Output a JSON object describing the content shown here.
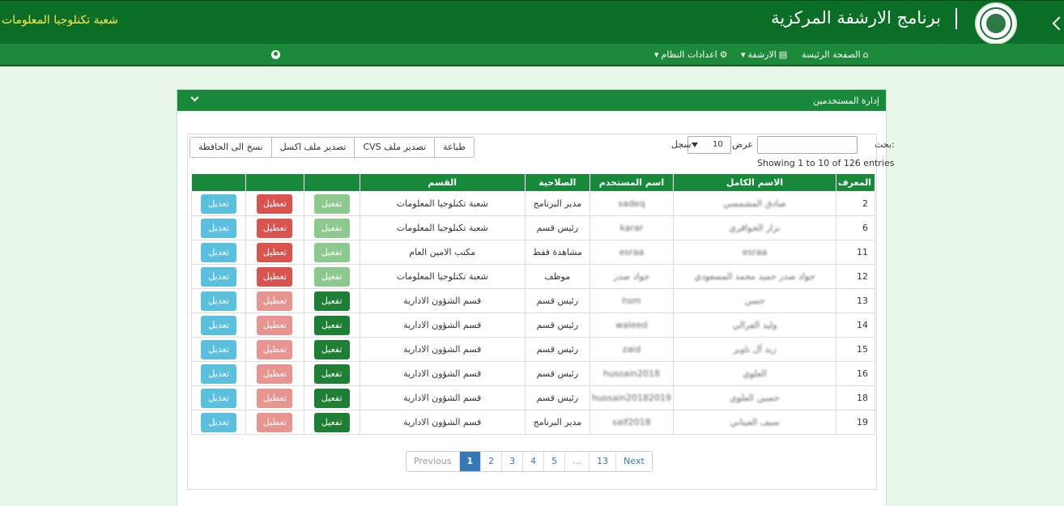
{
  "header": {
    "app_title": "برنامج الارشفة المركزية",
    "department": "شعبة تكنلوجيا المعلومات"
  },
  "nav": {
    "home": "الصفحة الرئيسة",
    "archive": "الارشفة",
    "settings": "اعدادات النظام"
  },
  "panel": {
    "title": "إدارة المستخدمين"
  },
  "toolbar": {
    "print": "طباعة",
    "export_csv": "تصدير ملف CVS",
    "export_excel": "تصدير ملف اكسل",
    "copy": "نسخ الى الحافظة"
  },
  "filters": {
    "search_label": "بحث:",
    "length_label": "عرض",
    "length_value": "10",
    "records_label": "سجل",
    "info": "Showing 1 to 10 of 126 entries"
  },
  "table": {
    "headers": [
      "المعرف",
      "الاسم الكامل",
      "اسم المستخدم",
      "الصلاحية",
      "القسم",
      "",
      "",
      ""
    ],
    "action_labels": {
      "activate": "تفعيل",
      "disable": "تعطيل",
      "edit": "تعديل"
    },
    "rows": [
      {
        "id": "2",
        "name": "صادق المشمسي",
        "user": "sadeq",
        "role": "مدير البرنامج",
        "dept": "شعبة تكنلوجيا المعلومات",
        "active": true
      },
      {
        "id": "6",
        "name": "نزار الحواقري",
        "user": "karar",
        "role": "رئيس قسم",
        "dept": "شعبة تكنلوجيا المعلومات",
        "active": true
      },
      {
        "id": "11",
        "name": "esraa",
        "user": "esraa",
        "role": "مشاهدة فقط",
        "dept": "مكتب الامين العام",
        "active": true
      },
      {
        "id": "12",
        "name": "جواد صدر حميد محمد المسعودي",
        "user": "جواد صدر",
        "role": "موظف",
        "dept": "شعبة تكنلوجيا المعلومات",
        "active": true
      },
      {
        "id": "13",
        "name": "حسن",
        "user": "hsm",
        "role": "رئيس قسم",
        "dept": "قسم الشؤون الادارية",
        "active": false
      },
      {
        "id": "14",
        "name": "وليد الفرالي",
        "user": "waleed",
        "role": "رئيس قسم",
        "dept": "قسم الشؤون الادارية",
        "active": false
      },
      {
        "id": "15",
        "name": "زيد آل ناوير",
        "user": "zaid",
        "role": "رئيس قسم",
        "dept": "قسم الشؤون الادارية",
        "active": false
      },
      {
        "id": "16",
        "name": "العلوي",
        "user": "hussain2018",
        "role": "رئيس قسم",
        "dept": "قسم الشؤون الادارية",
        "active": false
      },
      {
        "id": "18",
        "name": "حسين العلوي",
        "user": "hussain20182019",
        "role": "رئيس قسم",
        "dept": "قسم الشؤون الادارية",
        "active": false
      },
      {
        "id": "19",
        "name": "سيف العيناني",
        "user": "saif2018",
        "role": "مدير البرنامج",
        "dept": "قسم الشؤون الادارية",
        "active": false
      }
    ]
  },
  "pagination": {
    "previous": "Previous",
    "pages": [
      "1",
      "2",
      "3",
      "4",
      "5",
      "…",
      "13"
    ],
    "next": "Next",
    "current": "1"
  }
}
